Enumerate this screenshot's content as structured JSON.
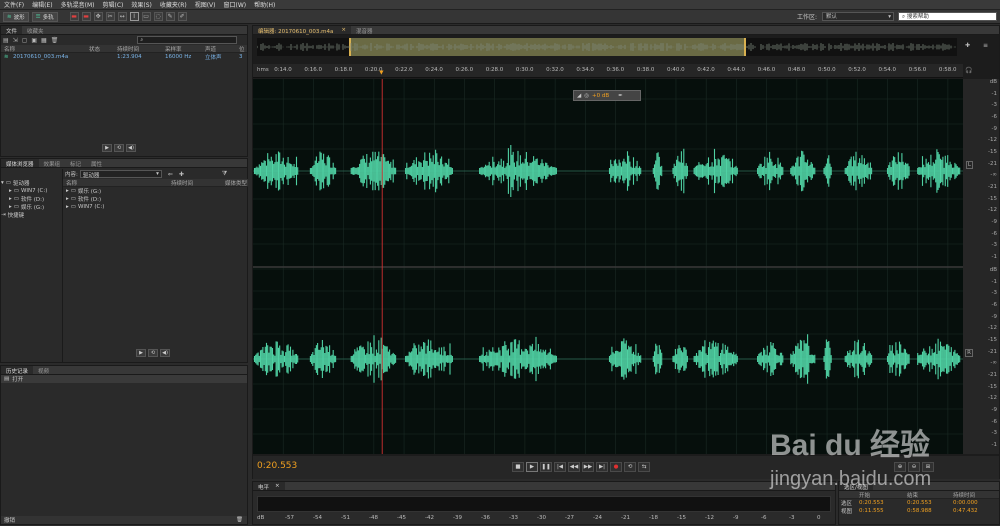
{
  "menu": [
    "文件(F)",
    "编辑(E)",
    "多轨混音(M)",
    "剪辑(C)",
    "效果(S)",
    "收藏夹(R)",
    "视图(V)",
    "窗口(W)",
    "帮助(H)"
  ],
  "toolbar": {
    "waveform_label": "波形",
    "multitrack_label": "多轨",
    "workspace_label": "工作区:",
    "workspace_value": "默认",
    "search_placeholder": "搜索帮助"
  },
  "files_panel": {
    "tabs": [
      "文件",
      "收藏夹"
    ],
    "columns": [
      "名称",
      "状态",
      "持续时间",
      "采样率",
      "声道",
      "位"
    ],
    "rows": [
      {
        "name": "20170610_003.m4a",
        "status": "",
        "duration": "1:23.904",
        "rate": "16000 Hz",
        "channels": "立体声",
        "bits": "3"
      }
    ]
  },
  "browser_panel": {
    "tabs": [
      "媒体浏览器",
      "效果组",
      "标记",
      "属性"
    ],
    "tree": [
      "驱动器",
      "WIN7 (C:)",
      "软件 (D:)",
      "娱乐 (G:)",
      "快捷键"
    ],
    "content_label": "内容:",
    "content_value": "驱动器",
    "columns": [
      "名称",
      "持续时间",
      "媒体类型"
    ],
    "items": [
      "娱乐 (G:)",
      "软件 (D:)",
      "WIN7 (C:)"
    ]
  },
  "history_panel": {
    "tabs": [
      "历史记录",
      "视频"
    ],
    "items": [
      "打开"
    ],
    "undo_label": "撤销"
  },
  "editor": {
    "tabs": [
      "编辑器: 20170610_003.m4a",
      "混音器"
    ],
    "hms_label": "hms",
    "time_ticks": [
      "0:14.0",
      "0:16.0",
      "0:18.0",
      "0:20.0",
      "0:22.0",
      "0:24.0",
      "0:26.0",
      "0:28.0",
      "0:30.0",
      "0:32.0",
      "0:34.0",
      "0:36.0",
      "0:38.0",
      "0:40.0",
      "0:42.0",
      "0:44.0",
      "0:46.0",
      "0:48.0",
      "0:50.0",
      "0:52.0",
      "0:54.0",
      "0:56.0",
      "0:58.0"
    ],
    "db_ticks": [
      "dB",
      "-1",
      "-3",
      "-6",
      "-9",
      "-12",
      "-15",
      "-21",
      "-∞",
      "-21",
      "-15",
      "-12",
      "-9",
      "-6",
      "-3",
      "-1"
    ],
    "channel_left": "L",
    "channel_right": "R",
    "hud_value": "+0 dB",
    "current_time": "0:20.553",
    "playhead_seconds": 20.553,
    "view_start_seconds": 12.0,
    "view_end_seconds": 59.0,
    "waveform_color": "#4fd1a3",
    "accent_color": "#f0a020"
  },
  "level_panel": {
    "title": "电平",
    "ticks": [
      "dB",
      "-57",
      "-54",
      "-51",
      "-48",
      "-45",
      "-42",
      "-39",
      "-36",
      "-33",
      "-30",
      "-27",
      "-24",
      "-21",
      "-18",
      "-15",
      "-12",
      "-9",
      "-6",
      "-3",
      "0"
    ]
  },
  "selection_panel": {
    "title": "选区/视图",
    "columns": [
      "开始",
      "结束",
      "持续时间"
    ],
    "rows": [
      {
        "label": "选区",
        "start": "0:20.553",
        "end": "0:20.553",
        "duration": "0:00.000"
      },
      {
        "label": "视图",
        "start": "0:11.555",
        "end": "0:58.988",
        "duration": "0:47.432"
      }
    ]
  },
  "watermark": {
    "brand": "Bai du 经验",
    "url": "jingyan.baidu.com"
  }
}
